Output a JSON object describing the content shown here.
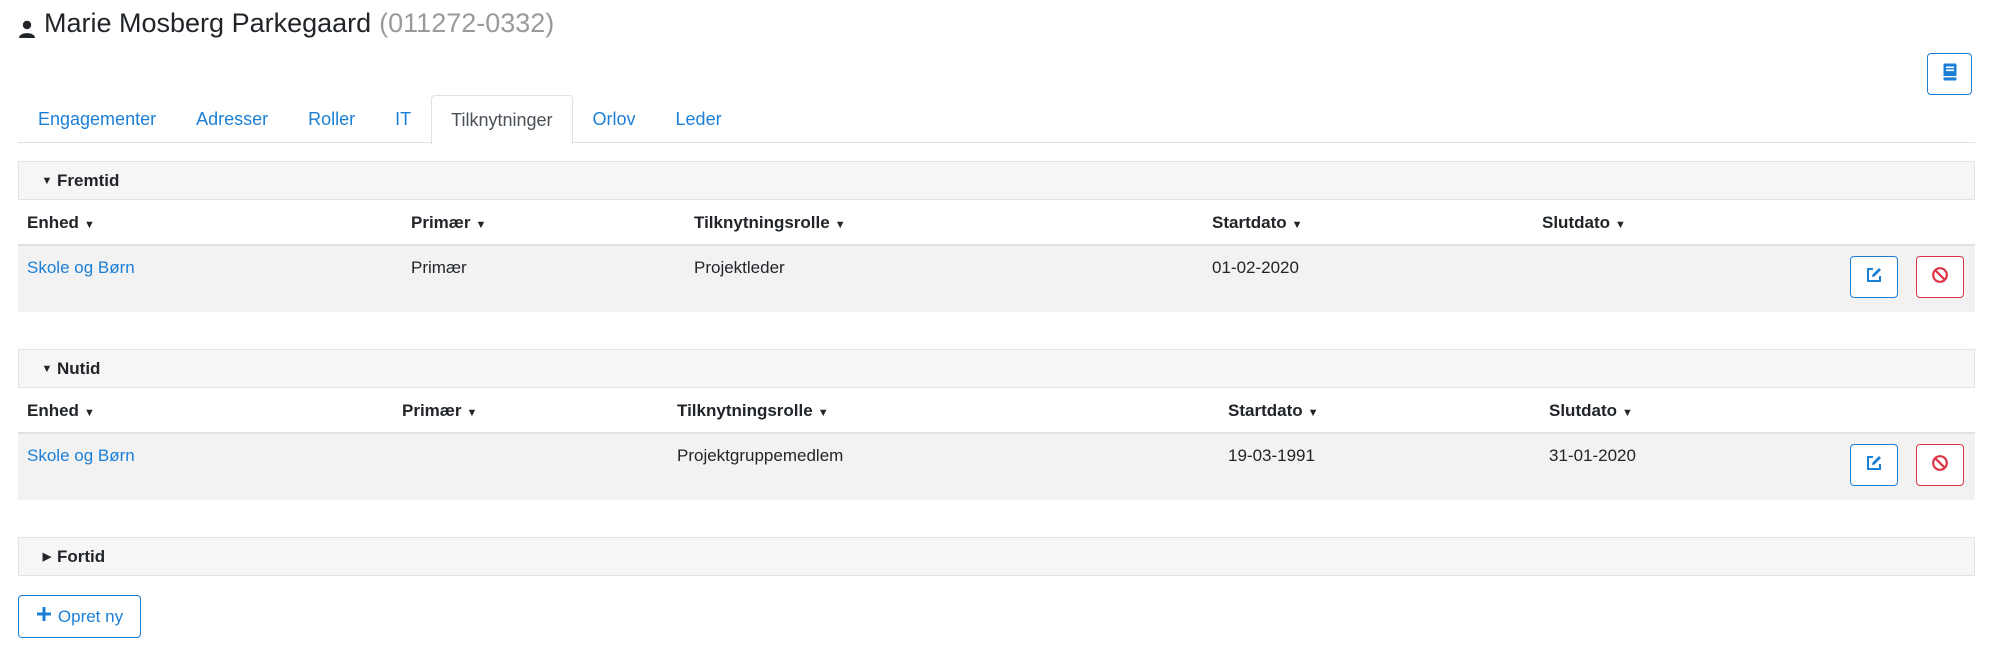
{
  "person": {
    "name": "Marie Mosberg Parkegaard",
    "cpr": "(011272-0332)"
  },
  "tabs": [
    {
      "label": "Engagementer",
      "active": false
    },
    {
      "label": "Adresser",
      "active": false
    },
    {
      "label": "Roller",
      "active": false
    },
    {
      "label": "IT",
      "active": false
    },
    {
      "label": "Tilknytninger",
      "active": true
    },
    {
      "label": "Orlov",
      "active": false
    },
    {
      "label": "Leder",
      "active": false
    }
  ],
  "sections": {
    "fremtid": {
      "title": "Fremtid",
      "columns": {
        "unit": "Enhed",
        "primary": "Primær",
        "role": "Tilknytningsrolle",
        "start": "Startdato",
        "end": "Slutdato"
      },
      "rows": [
        {
          "unit": "Skole og Børn",
          "primary": "Primær",
          "role": "Projektleder",
          "start": "01-02-2020",
          "end": ""
        }
      ]
    },
    "nutid": {
      "title": "Nutid",
      "columns": {
        "unit": "Enhed",
        "primary": "Primær",
        "role": "Tilknytningsrolle",
        "start": "Startdato",
        "end": "Slutdato"
      },
      "rows": [
        {
          "unit": "Skole og Børn",
          "primary": "",
          "role": "Projektgruppemedlem",
          "start": "19-03-1991",
          "end": "31-01-2020"
        }
      ]
    },
    "fortid": {
      "title": "Fortid"
    }
  },
  "actions": {
    "create_label": "Opret ny"
  },
  "icons": {
    "person": "user-icon",
    "book": "book-icon",
    "edit": "edit-icon",
    "delete": "ban-icon",
    "plus": "plus-icon",
    "sort": "caret-down-icon"
  },
  "colors": {
    "link": "#1b7fd6",
    "danger": "#dc3545",
    "muted": "#9a9a9a",
    "row_bg": "#f2f2f2",
    "header_bg": "#f6f6f6"
  }
}
